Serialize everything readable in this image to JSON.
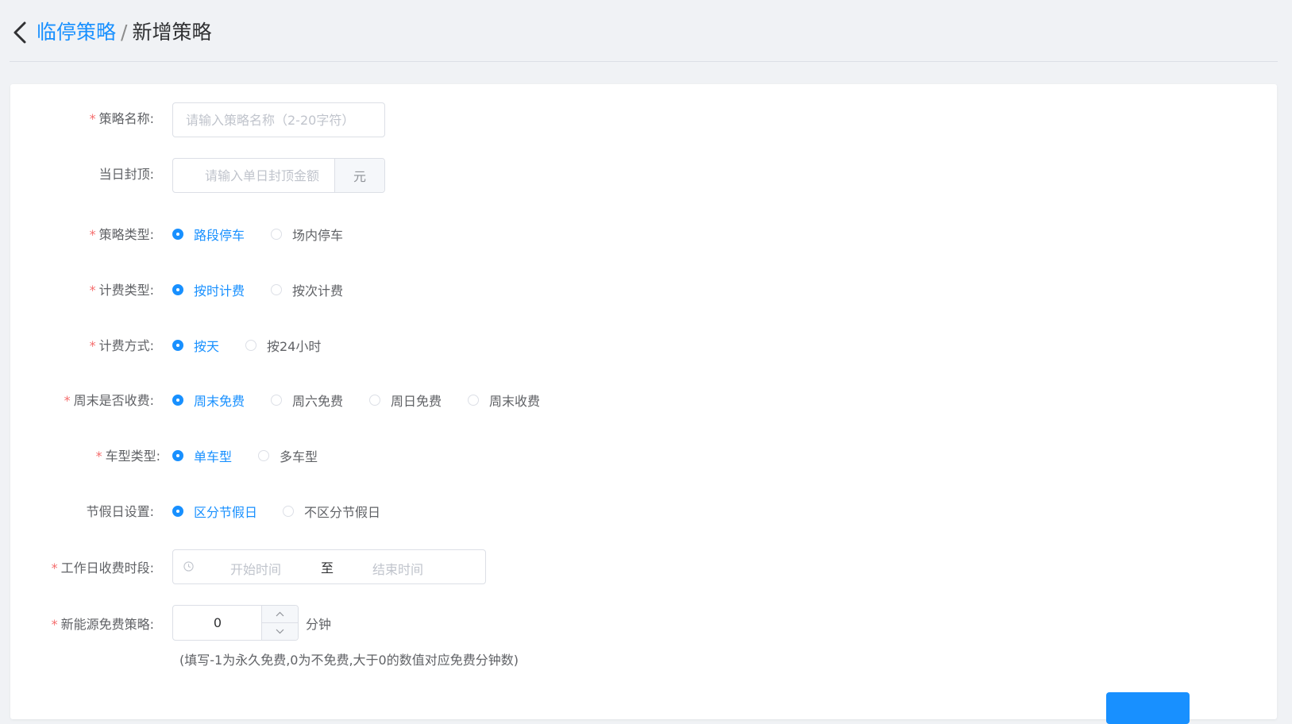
{
  "header": {
    "parent": "临停策略",
    "separator": "/",
    "current": "新增策略"
  },
  "form": {
    "name": {
      "label": "策略名称:",
      "required": "*",
      "placeholder": "请输入策略名称（2-20字符）"
    },
    "cap": {
      "label": "当日封顶:",
      "placeholder": "请输入单日封顶金额",
      "unit": "元"
    },
    "policy_type": {
      "label": "策略类型:",
      "required": "*",
      "options": [
        "路段停车",
        "场内停车"
      ],
      "selected": "路段停车"
    },
    "fee_type": {
      "label": "计费类型:",
      "required": "*",
      "options": [
        "按时计费",
        "按次计费"
      ],
      "selected": "按时计费"
    },
    "fee_mode": {
      "label": "计费方式:",
      "required": "*",
      "options": [
        "按天",
        "按24小时"
      ],
      "selected": "按天"
    },
    "weekend": {
      "label": "周末是否收费:",
      "required": "*",
      "options": [
        "周末免费",
        "周六免费",
        "周日免费",
        "周末收费"
      ],
      "selected": "周末免费"
    },
    "vehicle": {
      "label": "车型类型:",
      "required": "*",
      "options": [
        "单车型",
        "多车型"
      ],
      "selected": "单车型"
    },
    "holiday": {
      "label": "节假日设置:",
      "options": [
        "区分节假日",
        "不区分节假日"
      ],
      "selected": "区分节假日"
    },
    "workday_period": {
      "label": "工作日收费时段:",
      "required": "*",
      "start_placeholder": "开始时间",
      "range_separator": "至",
      "end_placeholder": "结束时间"
    },
    "new_energy": {
      "label": "新能源免费策略:",
      "required": "*",
      "value": "0",
      "unit": "分钟",
      "hint": "(填写-1为永久免费,0为不免费,大于0的数值对应免费分钟数)"
    }
  },
  "colors": {
    "primary": "#1890ff",
    "required": "#f56c6c",
    "background": "#f0f2f5"
  },
  "icons": {
    "back": "chevron-left-icon",
    "clock": "clock-icon",
    "up": "chevron-up-icon",
    "down": "chevron-down-icon"
  }
}
